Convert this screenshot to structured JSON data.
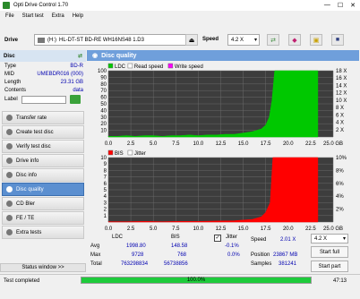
{
  "window": {
    "title": "Opti Drive Control 1.70",
    "min": "—",
    "max": "☐",
    "close": "✕"
  },
  "menu": [
    "File",
    "Start test",
    "Extra",
    "Help"
  ],
  "toolbar": {
    "drive_label": "Drive",
    "drive_letter": "(H:)",
    "drive_name": "HL-DT-ST BD-RE  WH16NS48 1.D3",
    "speed_label": "Speed",
    "speed_value": "4.2 X"
  },
  "disc": {
    "header": "Disc",
    "rows": [
      {
        "k": "Type",
        "v": "BD-R"
      },
      {
        "k": "MID",
        "v": "UMEBDR016 (000)"
      },
      {
        "k": "Length",
        "v": "23.31 GB"
      },
      {
        "k": "Contents",
        "v": "data"
      }
    ],
    "label_key": "Label"
  },
  "nav": [
    {
      "label": "Transfer rate",
      "active": false
    },
    {
      "label": "Create test disc",
      "active": false
    },
    {
      "label": "Verify test disc",
      "active": false
    },
    {
      "label": "Drive info",
      "active": false
    },
    {
      "label": "Disc info",
      "active": false
    },
    {
      "label": "Disc quality",
      "active": true
    },
    {
      "label": "CD Bler",
      "active": false
    },
    {
      "label": "FE / TE",
      "active": false
    },
    {
      "label": "Extra tests",
      "active": false
    }
  ],
  "status_window": "Status window >>",
  "panel_title": "Disc quality",
  "chart_data": [
    {
      "type": "area",
      "legend": [
        "LDC",
        "Read speed",
        "Write speed"
      ],
      "colors": {
        "LDC": "#00c800",
        "Read speed": "#ffffff",
        "Write speed": "#ff00ff"
      },
      "x_ticks": [
        "0.0",
        "2.5",
        "5.0",
        "7.5",
        "10.0",
        "12.5",
        "15.0",
        "17.5",
        "20.0",
        "22.5",
        "25.0 GB"
      ],
      "y_ticks_left": [
        "100",
        "90",
        "80",
        "70",
        "60",
        "50",
        "40",
        "30",
        "20",
        "10"
      ],
      "y_ticks_right": [
        "18 X",
        "16 X",
        "14 X",
        "12 X",
        "10 X",
        "8 X",
        "6 X",
        "4 X",
        "2 X"
      ],
      "xlim": [
        0,
        25
      ],
      "ylim": [
        0,
        100
      ],
      "x": [
        0,
        1,
        2,
        3,
        4,
        5,
        6,
        7,
        8,
        9,
        10,
        11,
        12,
        13,
        14,
        15,
        16,
        17,
        17.5,
        17.9,
        18.2,
        18.5,
        19,
        20,
        21,
        22,
        23,
        23.3
      ],
      "values": [
        1,
        1,
        2,
        1,
        2,
        2,
        1,
        2,
        2,
        3,
        2,
        3,
        3,
        4,
        4,
        6,
        8,
        12,
        18,
        30,
        55,
        100,
        100,
        100,
        100,
        100,
        100,
        100
      ]
    },
    {
      "type": "area",
      "legend": [
        "BIS",
        "Jitter"
      ],
      "colors": {
        "BIS": "#ff0000",
        "Jitter": "#ffffff"
      },
      "x_ticks": [
        "0.0",
        "2.5",
        "5.0",
        "7.5",
        "10.0",
        "12.5",
        "15.0",
        "17.5",
        "20.0",
        "22.5",
        "25.0 GB"
      ],
      "y_ticks_left": [
        "10",
        "9",
        "8",
        "7",
        "6",
        "5",
        "4",
        "3",
        "2",
        "1"
      ],
      "y_ticks_right": [
        "10%",
        "8%",
        "6%",
        "4%",
        "2%"
      ],
      "xlim": [
        0,
        25
      ],
      "ylim": [
        0,
        10
      ],
      "x": [
        0,
        2,
        4,
        6,
        8,
        10,
        12,
        14,
        15,
        16,
        17,
        17.5,
        18,
        18.3,
        18.5,
        20,
        22,
        23.3
      ],
      "values": [
        0.05,
        0.05,
        0.1,
        0.05,
        0.1,
        0.1,
        0.15,
        0.2,
        0.3,
        0.4,
        0.8,
        1.5,
        3,
        10,
        10,
        10,
        10,
        10
      ]
    }
  ],
  "stats": {
    "col_ldc": "LDC",
    "col_bis": "BIS",
    "avg_label": "Avg",
    "max_label": "Max",
    "total_label": "Total",
    "ldc": {
      "avg": "1998.80",
      "max": "9728",
      "total": "763298834"
    },
    "bis": {
      "avg": "148.58",
      "max": "768",
      "total": "56738856"
    },
    "jitter_label": "Jitter",
    "jitter_checked": "✓",
    "jitter": {
      "avg": "-0.1%",
      "max": "0.0%"
    },
    "speed_label": "Speed",
    "speed_value": "2.01 X",
    "position_label": "Position",
    "position_value": "23867 MB",
    "samples_label": "Samples",
    "samples_value": "381241",
    "speed_select": "4.2 X",
    "start_full": "Start full",
    "start_part": "Start part"
  },
  "statusbar": {
    "text": "Test completed",
    "progress": 100,
    "progress_text": "100.0%",
    "time": "47:13"
  }
}
